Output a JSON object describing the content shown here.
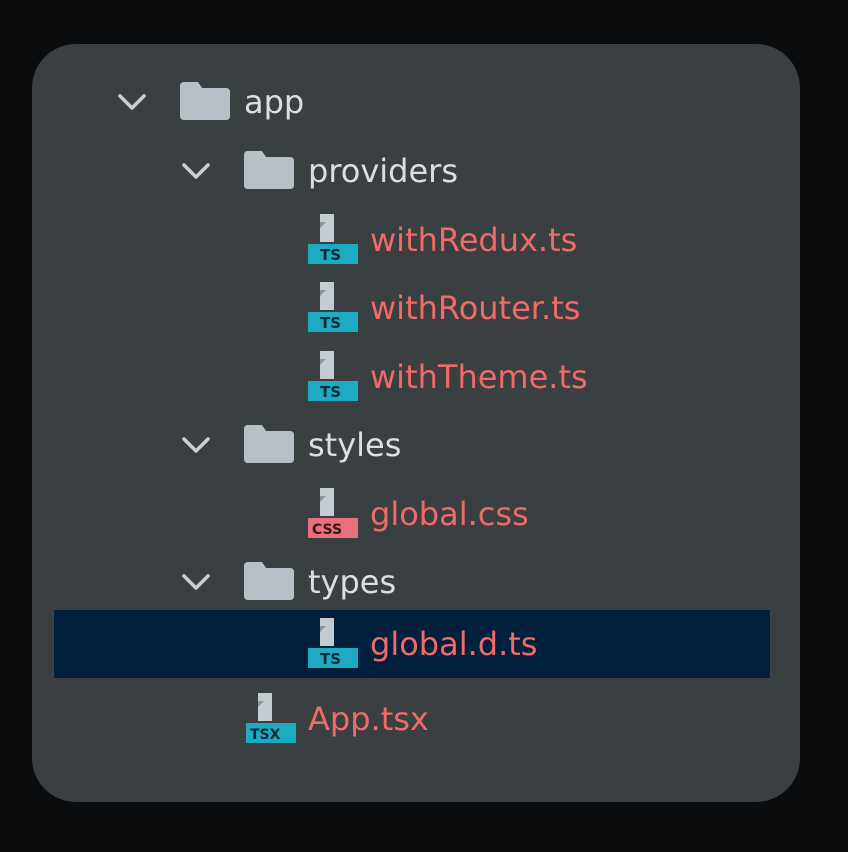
{
  "colors": {
    "background": "#0b0c0d",
    "panel": "#3a3f42",
    "selection": "#00203d",
    "folder_text": "#dcdfe1",
    "changed_file_text": "#f06a68",
    "folder_icon": "#b7c0c6",
    "ts_badge": "#1faac3",
    "css_badge": "#e8707c"
  },
  "tree": {
    "folders": {
      "app": {
        "label": "app",
        "expanded": true,
        "icon": "folder-icon"
      },
      "providers": {
        "label": "providers",
        "expanded": true,
        "icon": "folder-icon"
      },
      "styles": {
        "label": "styles",
        "expanded": true,
        "icon": "folder-icon"
      },
      "types": {
        "label": "types",
        "expanded": true,
        "icon": "folder-icon"
      }
    },
    "files": {
      "withRedux": {
        "label": "withRedux.ts",
        "badge": "TS",
        "icon": "typescript-file-icon"
      },
      "withRouter": {
        "label": "withRouter.ts",
        "badge": "TS",
        "icon": "typescript-file-icon"
      },
      "withTheme": {
        "label": "withTheme.ts",
        "badge": "TS",
        "icon": "typescript-file-icon"
      },
      "globalCss": {
        "label": "global.css",
        "badge": "CSS",
        "icon": "css-file-icon"
      },
      "globalDts": {
        "label": "global.d.ts",
        "badge": "TS",
        "icon": "typescript-file-icon",
        "selected": true
      },
      "appTsx": {
        "label": "App.tsx",
        "badge": "TSX",
        "icon": "tsx-file-icon"
      }
    }
  }
}
